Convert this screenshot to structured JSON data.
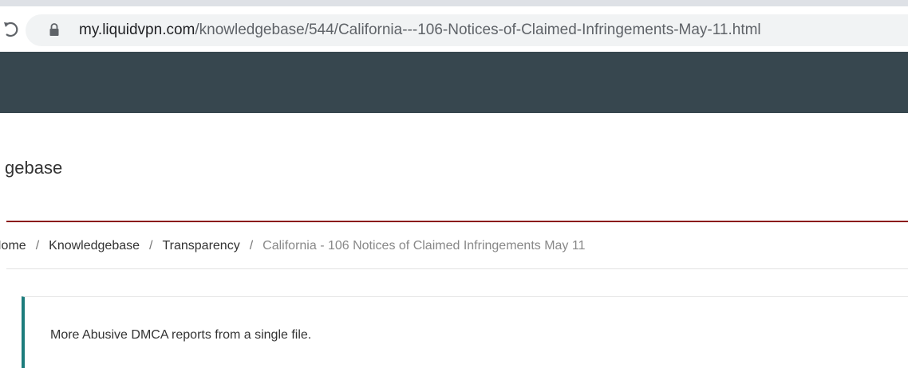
{
  "browser": {
    "url_host": "my.liquidvpn.com",
    "url_path": "/knowledgebase/544/California---106-Notices-of-Claimed-Infringements-May-11.html",
    "reload_icon": "reload-icon",
    "lock_icon": "lock-icon"
  },
  "page": {
    "heading": "gebase"
  },
  "breadcrumb": {
    "items": [
      "Home",
      "Knowledgebase",
      "Transparency"
    ],
    "separator": "/",
    "current": "California - 106 Notices of Claimed Infringements May 11"
  },
  "article": {
    "text": "More Abusive DMCA reports from a single file."
  },
  "colors": {
    "navbar": "#37474f",
    "heading_rule": "#8b1a1a",
    "article_accent": "#1c7c7c"
  }
}
